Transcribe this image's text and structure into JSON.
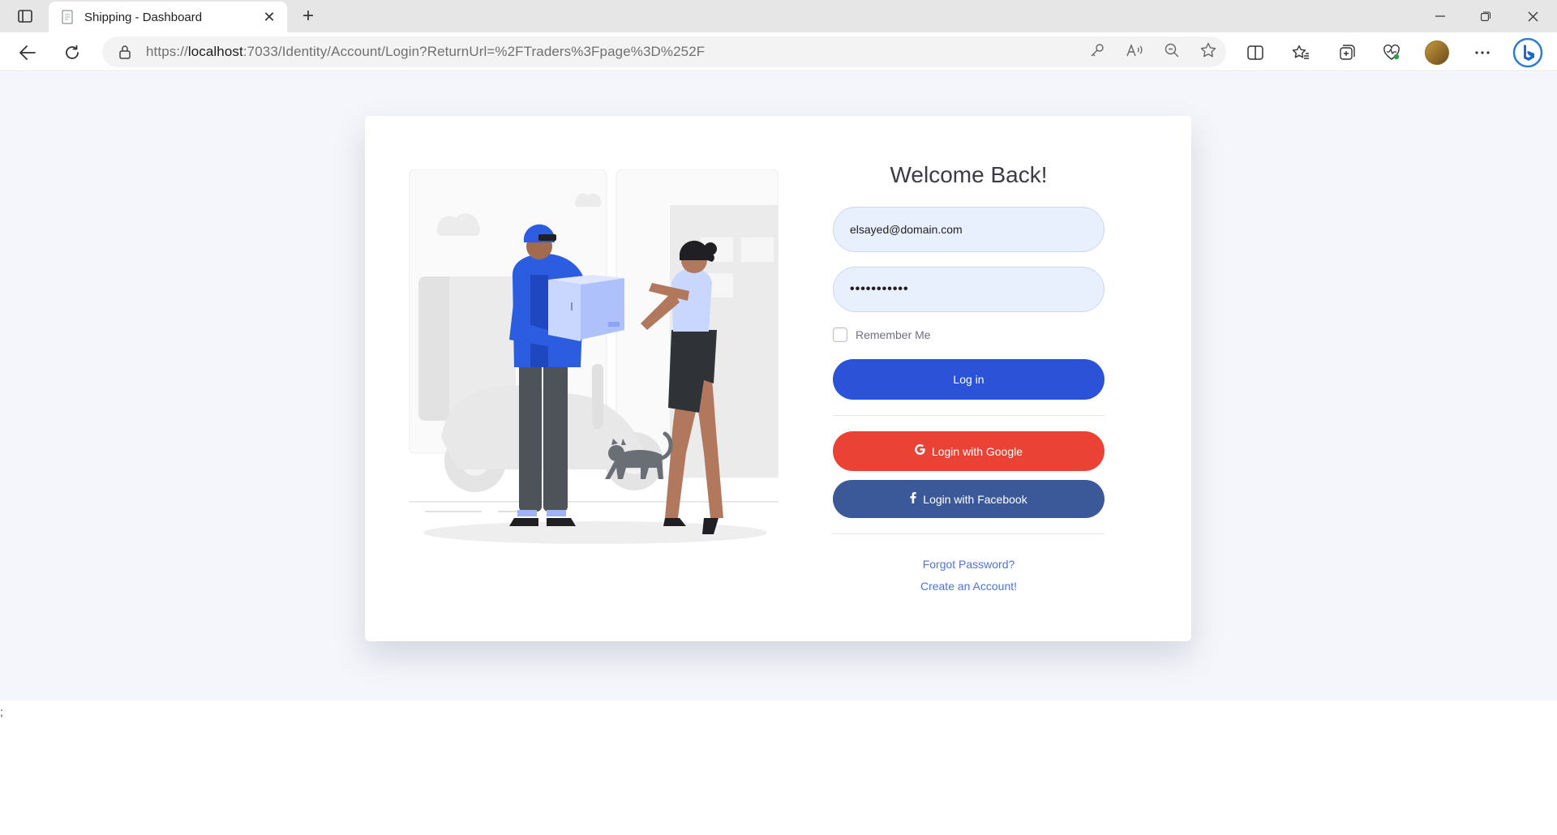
{
  "browser": {
    "tab_title": "Shipping - Dashboard",
    "url_prefix": "https://",
    "url_host": "localhost",
    "url_rest": ":7033/Identity/Account/Login?ReturnUrl=%2FTraders%3Fpage%3D%252F"
  },
  "login": {
    "heading": "Welcome Back!",
    "email_value": "elsayed@domain.com",
    "password_value": "•••••••••••",
    "remember_label": "Remember Me",
    "login_button": "Log in",
    "google_button": "Login with Google",
    "facebook_button": "Login with Facebook",
    "forgot_link": "Forgot Password?",
    "create_link": "Create an Account!"
  },
  "footer": {
    "stray_text": ";"
  },
  "colors": {
    "primary": "#2c52d7",
    "google": "#ea4335",
    "facebook": "#3b5998",
    "link": "#4e73df",
    "page_bg": "#f5f6fb"
  },
  "icons": [
    "sidebar-toggle-icon",
    "document-icon",
    "close-icon",
    "plus-icon",
    "back-icon",
    "refresh-icon",
    "lock-icon",
    "key-icon",
    "read-aloud-icon",
    "zoom-out-icon",
    "star-icon",
    "split-screen-icon",
    "favorites-icon",
    "collections-icon",
    "browser-essentials-icon",
    "more-icon",
    "bing-icon",
    "google-icon",
    "facebook-icon"
  ]
}
